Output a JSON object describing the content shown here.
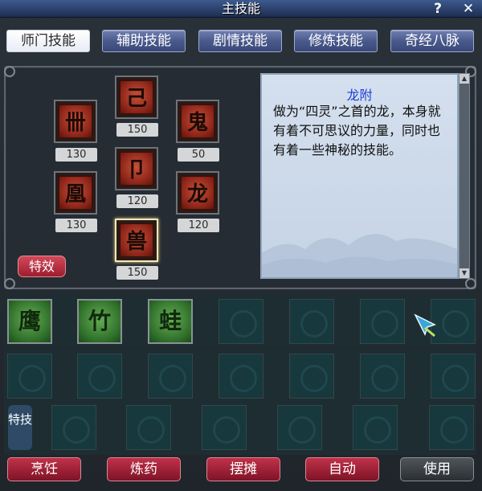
{
  "window": {
    "title": "主技能",
    "help_icon": "?",
    "close_icon": "✕"
  },
  "tabs": [
    {
      "label": "师门技能",
      "active": true
    },
    {
      "label": "辅助技能",
      "active": false
    },
    {
      "label": "剧情技能",
      "active": false
    },
    {
      "label": "修炼技能",
      "active": false
    },
    {
      "label": "奇经八脉",
      "active": false
    }
  ],
  "skills": [
    {
      "icon": "beast-rune-icon",
      "level": "130"
    },
    {
      "icon": "dragon-coil-icon",
      "level": "150"
    },
    {
      "icon": "monster-face-icon",
      "level": "50"
    },
    {
      "icon": "sword-rune-icon",
      "level": "120"
    },
    {
      "icon": "seal-rune-icon",
      "level": "130"
    },
    {
      "icon": "dragon-head-icon",
      "level": "120"
    },
    {
      "icon": "dragon-attach-icon",
      "level": "150",
      "selected": true
    }
  ],
  "effect_button": "特效",
  "description": {
    "title": "龙附",
    "text": "做为“四灵”之首的龙，本身就有着不可思议的力量，同时也有着一些神秘的技能。"
  },
  "quick_slots": [
    {
      "icon": "eagle-icon",
      "filled": true
    },
    {
      "icon": "bamboo-icon",
      "filled": true
    },
    {
      "icon": "frog-icon",
      "filled": true
    },
    {
      "filled": false
    },
    {
      "filled": false
    },
    {
      "filled": false
    },
    {
      "filled": false
    }
  ],
  "special_label": "特技",
  "bottom_buttons": [
    "烹饪",
    "炼药",
    "摆摊",
    "自动",
    "使用"
  ],
  "colors": {
    "tab_active": "#ffffff",
    "button_red": "#9c1d2e",
    "desc_title": "#1c3cd6",
    "slot_bg": "#17383c"
  }
}
